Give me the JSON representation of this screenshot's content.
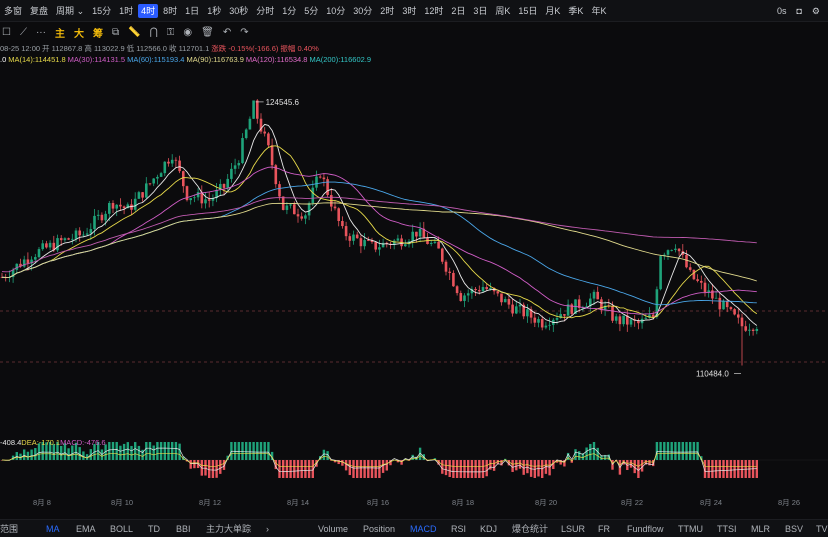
{
  "toolbar": {
    "items": [
      "多窗",
      "复盘",
      "周期",
      "15分",
      "1时",
      "4时",
      "8时",
      "1日",
      "1秒",
      "30秒",
      "分时",
      "1分",
      "5分",
      "10分",
      "30分",
      "2时",
      "3时",
      "12时",
      "2日",
      "3日",
      "周K",
      "15日",
      "月K",
      "季K",
      "年K"
    ],
    "active_index": 5,
    "right_items": [
      "0s"
    ]
  },
  "drawbar": {
    "main": [
      "主",
      "大",
      "筹"
    ]
  },
  "ohlc": [
    {
      "t": "08-25 12:00",
      "c": "#9aa0a6"
    },
    {
      "t": "开 112867.8",
      "c": "#9aa0a6"
    },
    {
      "t": "高 113022.9",
      "c": "#9aa0a6"
    },
    {
      "t": "低 112566.0",
      "c": "#9aa0a6"
    },
    {
      "t": "收 112701.1",
      "c": "#9aa0a6"
    },
    {
      "t": "涨跌 -0.15%(-166.6)",
      "c": "#e8545c"
    },
    {
      "t": "振幅 0.40%",
      "c": "#e8545c"
    }
  ],
  "ma_values": [
    {
      "t": ".0",
      "c": "#ffffff"
    },
    {
      "t": "MA(14):114451.8",
      "c": "#e6d94a"
    },
    {
      "t": "MA(30):114131.5",
      "c": "#d05dc6"
    },
    {
      "t": "MA(60):115193.4",
      "c": "#4aa6e8"
    },
    {
      "t": "MA(90):116763.9",
      "c": "#e0d98c"
    },
    {
      "t": "MA(120):116534.8",
      "c": "#e06cc8"
    },
    {
      "t": "MA(200):116602.9",
      "c": "#33c6c6"
    }
  ],
  "annotations": {
    "high": "124545.6",
    "low": "110484.0"
  },
  "macd": [
    {
      "t": "-408.4",
      "c": "#e6e6e6"
    },
    {
      "t": "DEA:-170.1",
      "c": "#e6d94a"
    },
    {
      "t": "MACD:-476.6",
      "c": "#d05dc6"
    }
  ],
  "dates": [
    "8月 8",
    "8月 10",
    "8月 12",
    "8月 14",
    "8月 16",
    "8月 18",
    "8月 20",
    "8月 22",
    "8月 24",
    "8月 26"
  ],
  "bottom": {
    "left": [
      "范围",
      "MA",
      "EMA",
      "BOLL",
      "TD",
      "BBI",
      "主力大单踪"
    ],
    "right": [
      "Volume",
      "Position",
      "MACD",
      "RSI",
      "KDJ",
      "爆仓统计",
      "LSUR",
      "FR",
      "Fundflow",
      "TTMU",
      "TTSI",
      "MLR",
      "BSV",
      "TV"
    ]
  },
  "colors": {
    "up": "#1fa37a",
    "down": "#e8545c",
    "accent": "#2b5cff"
  }
}
